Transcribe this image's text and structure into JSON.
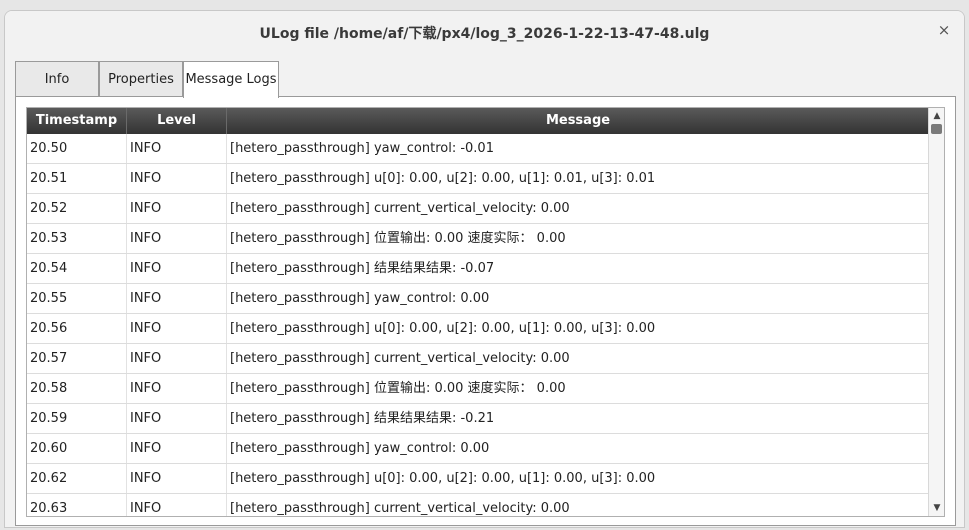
{
  "window": {
    "title": "ULog file /home/af/下载/px4/log_3_2026-1-22-13-47-48.ulg",
    "close_glyph": "×"
  },
  "tabs": [
    {
      "label": "Info"
    },
    {
      "label": "Properties"
    },
    {
      "label": "Message Logs",
      "active": true
    }
  ],
  "table": {
    "columns": [
      "Timestamp",
      "Level",
      "Message"
    ],
    "rows": [
      [
        "20.50",
        "INFO",
        "[hetero_passthrough] yaw_control: -0.01"
      ],
      [
        "20.51",
        "INFO",
        "[hetero_passthrough] u[0]: 0.00, u[2]: 0.00, u[1]: 0.01, u[3]: 0.01"
      ],
      [
        "20.52",
        "INFO",
        "[hetero_passthrough] current_vertical_velocity: 0.00"
      ],
      [
        "20.53",
        "INFO",
        "[hetero_passthrough] 位置输出: 0.00  速度实际：  0.00"
      ],
      [
        "20.54",
        "INFO",
        "[hetero_passthrough] 结果结果结果: -0.07"
      ],
      [
        "20.55",
        "INFO",
        "[hetero_passthrough] yaw_control: 0.00"
      ],
      [
        "20.56",
        "INFO",
        "[hetero_passthrough] u[0]: 0.00, u[2]: 0.00, u[1]: 0.00, u[3]: 0.00"
      ],
      [
        "20.57",
        "INFO",
        "[hetero_passthrough] current_vertical_velocity: 0.00"
      ],
      [
        "20.58",
        "INFO",
        "[hetero_passthrough] 位置输出: 0.00  速度实际：  0.00"
      ],
      [
        "20.59",
        "INFO",
        "[hetero_passthrough] 结果结果结果: -0.21"
      ],
      [
        "20.60",
        "INFO",
        "[hetero_passthrough] yaw_control: 0.00"
      ],
      [
        "20.62",
        "INFO",
        "[hetero_passthrough] u[0]: 0.00, u[2]: 0.00, u[1]: 0.00, u[3]: 0.00"
      ],
      [
        "20.63",
        "INFO",
        "[hetero_passthrough] current_vertical_velocity: 0.00"
      ]
    ]
  },
  "scrollbar": {
    "up_glyph": "▲",
    "down_glyph": "▼"
  }
}
